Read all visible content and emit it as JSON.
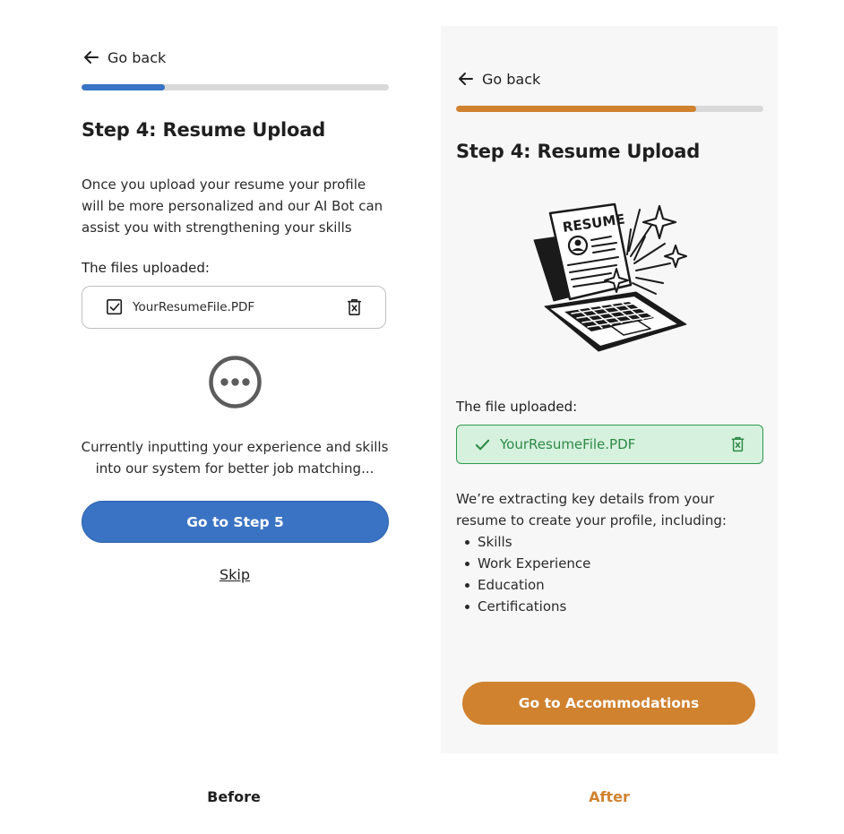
{
  "before": {
    "back_label": "Go back",
    "progress": 0.27,
    "progress_color": "#3a73c4",
    "title": "Step 4: Resume Upload",
    "description": "Once you upload your resume your profile will be more personalized and our AI Bot can assist you with strengthening your skills",
    "files_label": "The files uploaded:",
    "file_name": "YourResumeFile.PDF",
    "status_text": "Currently inputting  your experience and skills into our system for better job matching...",
    "primary_button": "Go to Step 5",
    "skip_label": "Skip",
    "caption": "Before"
  },
  "after": {
    "back_label": "Go back",
    "progress": 0.78,
    "progress_color": "#d0822f",
    "title": "Step 4: Resume Upload",
    "illustration_text": "RESUME",
    "file_label": "The file uploaded:",
    "file_name": "YourResumeFile.PDF",
    "extract_text": "We’re extracting key details from your resume to create your profile, including:",
    "extract_items": [
      "Skills",
      "Work Experience",
      "Education",
      "Certifications"
    ],
    "primary_button": "Go to Accommodations",
    "caption": "After"
  },
  "colors": {
    "before_accent": "#3a73c4",
    "after_accent": "#d0822f",
    "success_bg": "#d6f1de",
    "success_border": "#2e9a50"
  },
  "icons": {
    "back": "arrow-left-icon",
    "checkbox": "checkbox-checked-icon",
    "delete": "trash-icon",
    "loading": "more-dots-icon",
    "check": "check-icon",
    "illustration": "resume-laptop-illustration"
  }
}
